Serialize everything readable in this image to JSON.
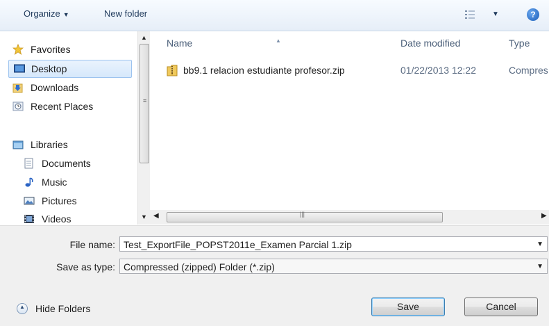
{
  "toolbar": {
    "organize_label": "Organize",
    "new_folder_label": "New folder",
    "help_label": "?"
  },
  "nav": {
    "favorites": {
      "label": "Favorites",
      "icon": "star-icon"
    },
    "favorite_items": [
      {
        "label": "Desktop",
        "icon": "desktop-icon",
        "selected": true
      },
      {
        "label": "Downloads",
        "icon": "downloads-icon",
        "selected": false
      },
      {
        "label": "Recent Places",
        "icon": "recent-places-icon",
        "selected": false
      }
    ],
    "libraries": {
      "label": "Libraries",
      "icon": "library-icon"
    },
    "library_items": [
      {
        "label": "Documents",
        "icon": "documents-icon"
      },
      {
        "label": "Music",
        "icon": "music-icon"
      },
      {
        "label": "Pictures",
        "icon": "pictures-icon"
      },
      {
        "label": "Videos",
        "icon": "videos-icon"
      }
    ]
  },
  "list": {
    "columns": {
      "name": "Name",
      "date": "Date modified",
      "type": "Type"
    },
    "files": [
      {
        "name": "bb9.1 relacion estudiante profesor.zip",
        "date": "01/22/2013 12:22",
        "type": "Compres",
        "icon": "zip-folder-icon"
      }
    ]
  },
  "form": {
    "file_name_label": "File name:",
    "file_name_value": "Test_ExportFile_POPST2011e_Examen Parcial 1.zip",
    "save_as_type_label": "Save as type:",
    "save_as_type_value": "Compressed (zipped) Folder (*.zip)"
  },
  "footer": {
    "hide_folders_label": "Hide Folders",
    "save_label": "Save",
    "cancel_label": "Cancel"
  },
  "colors": {
    "toolbar_text": "#1e395b",
    "selection_border": "#9cc3ef",
    "panel_bg": "#f0f0f0"
  }
}
